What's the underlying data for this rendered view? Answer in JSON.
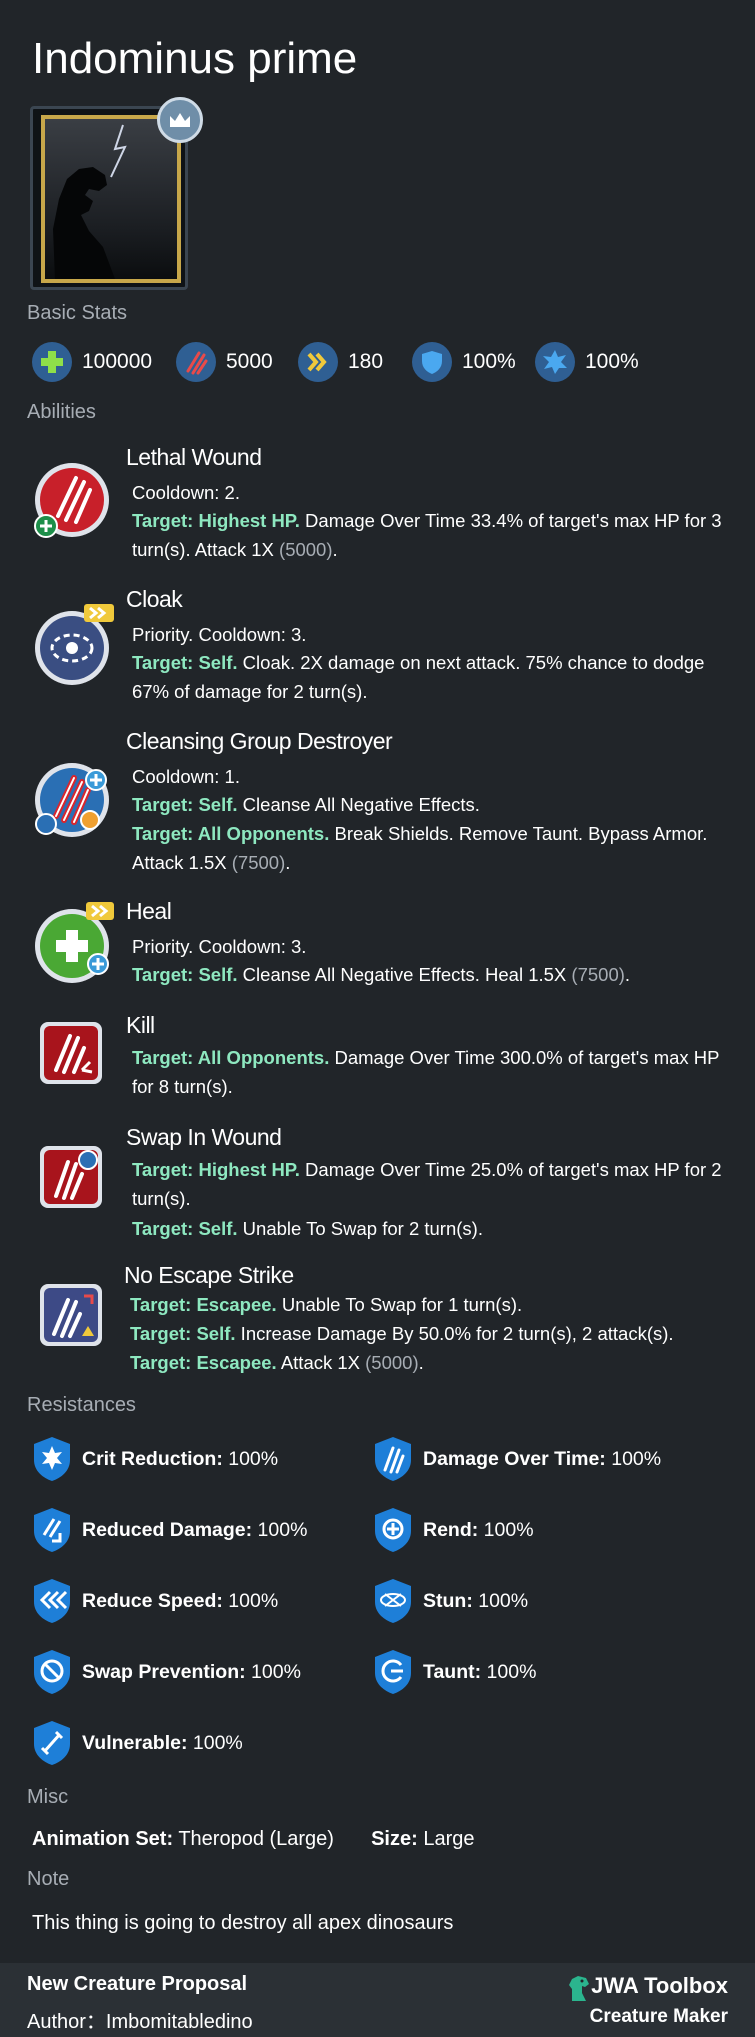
{
  "creature": {
    "name": "Indominus prime"
  },
  "sections": {
    "basic_stats": "Basic Stats",
    "abilities": "Abilities",
    "resistances": "Resistances",
    "misc": "Misc",
    "note": "Note"
  },
  "stats": {
    "health": "100000",
    "damage": "5000",
    "speed": "180",
    "armor": "100%",
    "crit": "100%"
  },
  "abilities": [
    {
      "name": "Lethal Wound",
      "cd": "Cooldown: 2.",
      "lines": [
        {
          "t": "Target: Highest HP.",
          "d": " Damage Over Time 33.4% of target's max HP for 3 turn(s). Attack 1X ",
          "v": "(5000)",
          "e": "."
        }
      ]
    },
    {
      "name": "Cloak",
      "cd": "Priority. Cooldown: 3.",
      "lines": [
        {
          "t": "Target: Self.",
          "d": " Cloak. 2X damage on next attack. 75% chance to dodge 67% of damage for 2 turn(s).",
          "v": "",
          "e": ""
        }
      ]
    },
    {
      "name": "Cleansing Group Destroyer",
      "cd": "Cooldown: 1.",
      "lines": [
        {
          "t": "Target: Self.",
          "d": " Cleanse All Negative Effects.",
          "v": "",
          "e": ""
        },
        {
          "t": "Target: All Opponents.",
          "d": " Break Shields. Remove Taunt. Bypass Armor. Attack 1.5X ",
          "v": "(7500)",
          "e": "."
        }
      ]
    },
    {
      "name": "Heal",
      "cd": "Priority. Cooldown: 3.",
      "lines": [
        {
          "t": "Target: Self.",
          "d": " Cleanse All Negative Effects. Heal 1.5X ",
          "v": "(7500)",
          "e": "."
        }
      ]
    },
    {
      "name": "Kill",
      "cd": "",
      "lines": [
        {
          "t": "Target: All Opponents.",
          "d": " Damage Over Time 300.0% of target's max HP for 8 turn(s).",
          "v": "",
          "e": ""
        }
      ]
    },
    {
      "name": "Swap In Wound",
      "cd": "",
      "lines": [
        {
          "t": "Target: Highest HP.",
          "d": " Damage Over Time 25.0% of target's max HP for 2 turn(s).",
          "v": "",
          "e": ""
        },
        {
          "t": "Target: Self.",
          "d": " Unable To Swap for 2 turn(s).",
          "v": "",
          "e": ""
        }
      ]
    },
    {
      "name": "No Escape Strike",
      "cd": "",
      "lines": [
        {
          "t": "Target: Escapee.",
          "d": " Unable To Swap for 1 turn(s).",
          "v": "",
          "e": ""
        },
        {
          "t": "Target: Self.",
          "d": " Increase Damage By 50.0% for 2 turn(s), 2 attack(s).",
          "v": "",
          "e": ""
        },
        {
          "t": "Target: Escapee.",
          "d": " Attack 1X ",
          "v": "(5000)",
          "e": "."
        }
      ]
    }
  ],
  "resistances": [
    {
      "label": "Crit Reduction:",
      "value": " 100%",
      "icon": "crit-reduction-icon"
    },
    {
      "label": "Damage Over Time:",
      "value": " 100%",
      "icon": "damage-over-time-icon"
    },
    {
      "label": "Reduced Damage:",
      "value": " 100%",
      "icon": "reduced-damage-icon"
    },
    {
      "label": "Rend:",
      "value": " 100%",
      "icon": "rend-icon"
    },
    {
      "label": "Reduce Speed:",
      "value": " 100%",
      "icon": "reduce-speed-icon"
    },
    {
      "label": "Stun:",
      "value": " 100%",
      "icon": "stun-icon"
    },
    {
      "label": "Swap Prevention:",
      "value": " 100%",
      "icon": "swap-prevention-icon"
    },
    {
      "label": "Taunt:",
      "value": " 100%",
      "icon": "taunt-icon"
    },
    {
      "label": "Vulnerable:",
      "value": " 100%",
      "icon": "vulnerable-icon"
    }
  ],
  "misc": {
    "animation_label": "Animation Set:",
    "animation_value": " Theropod (Large)",
    "size_label": "Size:",
    "size_value": " Large"
  },
  "note": {
    "text": "This thing is going to destroy all apex dinosaurs"
  },
  "footer": {
    "proposal": "New Creature Proposal",
    "author": "Author：Imbomitabledino",
    "brand": "JWA Toolbox",
    "tool": "Creature Maker"
  },
  "colors": {
    "background": "#212529",
    "cooldown": "#f0c93b",
    "target": "#8ee8c0",
    "muted": "#a7adb4",
    "stat_circle": "#2f5f93"
  }
}
